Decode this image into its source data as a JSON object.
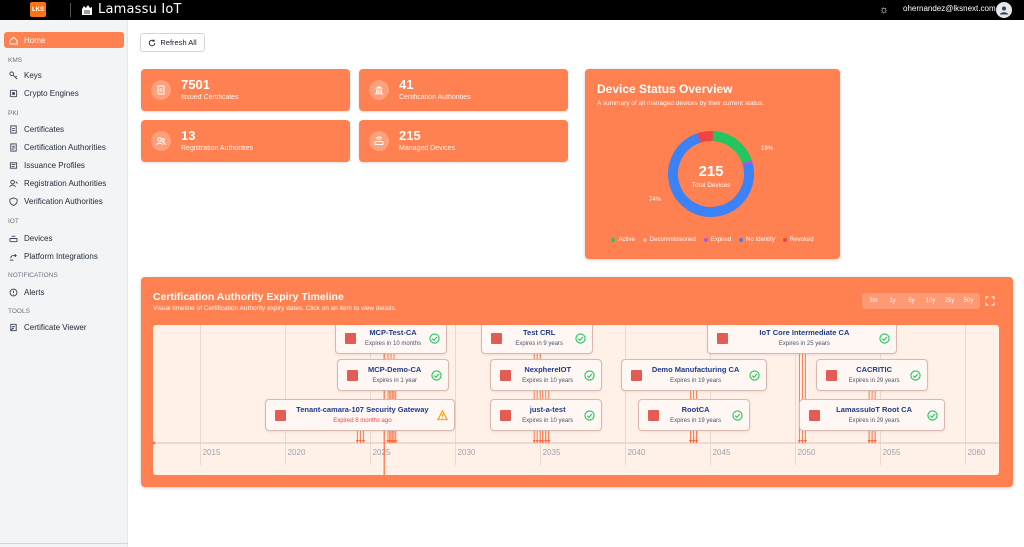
{
  "topbar": {
    "logo_text": "LKS",
    "brand": "Lamassu IoT",
    "user_email": "ohernandez@lksnext.com"
  },
  "sidebar": {
    "items": [
      {
        "label": "Home",
        "icon": "home-icon",
        "active": true
      },
      {
        "section": "KMS"
      },
      {
        "label": "Keys",
        "icon": "key-icon"
      },
      {
        "label": "Crypto Engines",
        "icon": "engine-icon"
      },
      {
        "section": "PKI"
      },
      {
        "label": "Certificates",
        "icon": "certificate-icon"
      },
      {
        "label": "Certification Authorities",
        "icon": "ca-icon"
      },
      {
        "label": "Issuance Profiles",
        "icon": "profile-icon"
      },
      {
        "label": "Registration Authorities",
        "icon": "ra-icon"
      },
      {
        "label": "Verification Authorities",
        "icon": "shield-icon"
      },
      {
        "section": "IoT"
      },
      {
        "label": "Devices",
        "icon": "devices-icon"
      },
      {
        "label": "Platform Integrations",
        "icon": "integration-icon"
      },
      {
        "section": "NOTIFICATIONS"
      },
      {
        "label": "Alerts",
        "icon": "alert-icon"
      },
      {
        "section": "TOOLS"
      },
      {
        "label": "Certificate Viewer",
        "icon": "viewer-icon"
      }
    ]
  },
  "toolbar": {
    "refresh_label": "Refresh All"
  },
  "stats": [
    {
      "value": "7501",
      "label": "Issued Certificates",
      "icon": "certificate-icon"
    },
    {
      "value": "41",
      "label": "Certification Authorities",
      "icon": "bank-icon"
    },
    {
      "value": "13",
      "label": "Registration Authorities",
      "icon": "users-icon"
    },
    {
      "value": "215",
      "label": "Managed Devices",
      "icon": "router-icon"
    }
  ],
  "device_status": {
    "title": "Device Status Overview",
    "subtitle": "A summary of all managed devices by their current status.",
    "total": "215",
    "total_label": "Total Devices",
    "pct_top": "19%",
    "pct_bottom": "74%",
    "segments": [
      {
        "name": "Active",
        "value": 0.19,
        "color": "#22c55e"
      },
      {
        "name": "Decommissioned",
        "value": 0.0,
        "color": "#ffb199"
      },
      {
        "name": "Expired",
        "value": 0.01,
        "color": "#a855f7"
      },
      {
        "name": "No Identity",
        "value": 0.74,
        "color": "#3b82f6"
      },
      {
        "name": "Revoked",
        "value": 0.06,
        "color": "#ef4444"
      }
    ]
  },
  "timeline": {
    "title": "Certification Authority Expiry Timeline",
    "subtitle": "Visual timeline of Certification Authority expiry dates. Click on an item to view details.",
    "zoom_options": [
      "3m",
      "1y",
      "5y",
      "10y",
      "25y",
      "50y"
    ],
    "axis_years": [
      "2015",
      "2020",
      "2025",
      "2030",
      "2035",
      "2040",
      "2045",
      "2050",
      "2055",
      "2060"
    ],
    "items": [
      {
        "name": "MCP-Test-CA",
        "expiry": "Expires in 10 months",
        "status": "ok",
        "row": 0,
        "year": 2026.2
      },
      {
        "name": "Test CRL",
        "expiry": "Expires in 9 years",
        "status": "ok",
        "row": 0,
        "year": 2034.8
      },
      {
        "name": "IoT Core Intermediate CA",
        "expiry": "Expires in 25 years",
        "status": "ok",
        "row": 0,
        "year": 2050.4
      },
      {
        "name": "MCP-Demo-CA",
        "expiry": "Expires in 1 year",
        "status": "ok",
        "row": 1,
        "year": 2026.3
      },
      {
        "name": "NexphereIOT",
        "expiry": "Expires in 10 years",
        "status": "ok",
        "row": 1,
        "year": 2035.3
      },
      {
        "name": "Demo Manufacturing CA",
        "expiry": "Expires in 19 years",
        "status": "ok",
        "row": 1,
        "year": 2044.0
      },
      {
        "name": "CACRITIC",
        "expiry": "Expires in 29 years",
        "status": "ok",
        "row": 1,
        "year": 2054.5
      },
      {
        "name": "Tenant-camara-107 Security Gateway",
        "expiry": "Expired 8 months ago",
        "status": "warn",
        "row": 2,
        "year": 2024.4
      },
      {
        "name": "just-a-test",
        "expiry": "Expires in 10 years",
        "status": "ok",
        "row": 2,
        "year": 2035.3
      },
      {
        "name": "RootCA",
        "expiry": "Expires in 19 years",
        "status": "ok",
        "row": 2,
        "year": 2044.0
      },
      {
        "name": "LamassuIoT Root CA",
        "expiry": "Expires in 29 years",
        "status": "ok",
        "row": 2,
        "year": 2054.5
      }
    ]
  }
}
